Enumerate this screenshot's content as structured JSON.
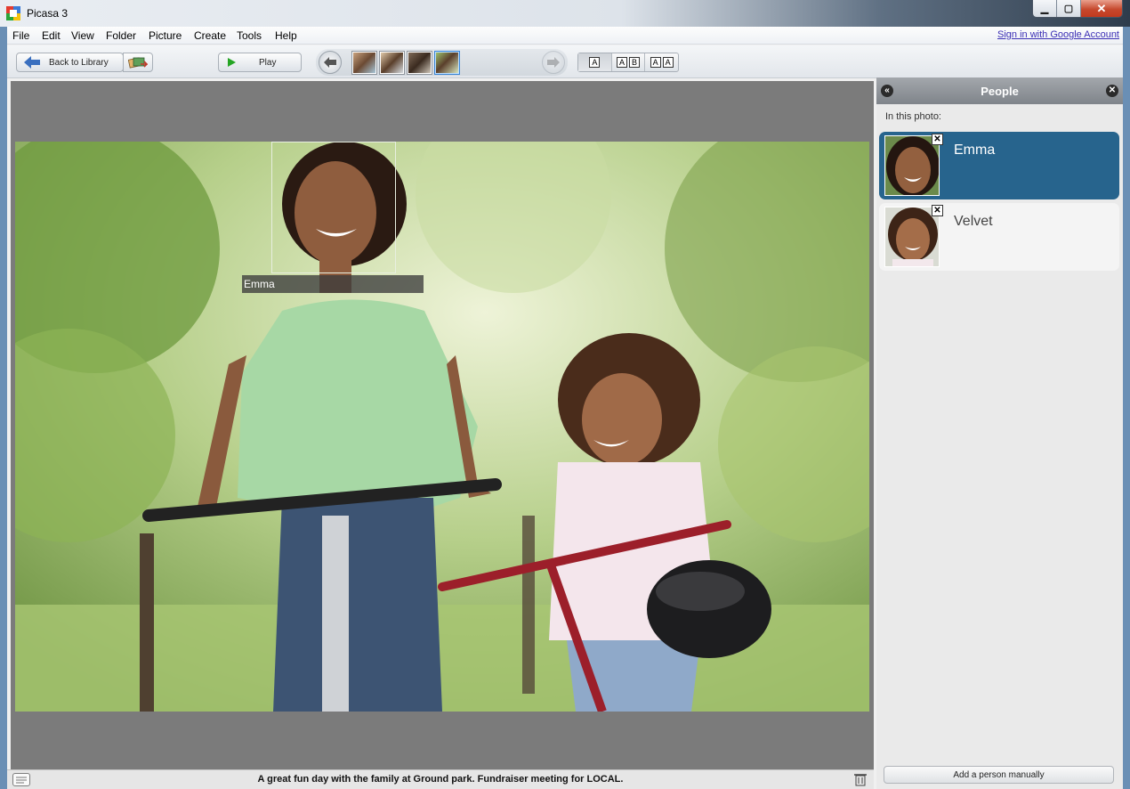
{
  "window": {
    "title": "Picasa 3",
    "min_glyph": "▁",
    "max_glyph": "▢",
    "close_glyph": "✕"
  },
  "menu": {
    "items": [
      {
        "label": "File"
      },
      {
        "label": "Edit"
      },
      {
        "label": "View"
      },
      {
        "label": "Folder"
      },
      {
        "label": "Picture"
      },
      {
        "label": "Create"
      },
      {
        "label": "Tools"
      },
      {
        "label": "Help"
      }
    ],
    "signin": "Sign in with Google Account"
  },
  "toolbar": {
    "back_label": "Back to Library",
    "play_label": "Play",
    "text_modes": [
      {
        "boxes": [
          "A"
        ]
      },
      {
        "boxes": [
          "A",
          "B"
        ]
      },
      {
        "boxes": [
          "A",
          "A"
        ]
      }
    ]
  },
  "photo": {
    "face_label": "Emma"
  },
  "caption": "A great fun day with the family at Ground park. Fundraiser meeting for LOCAL.",
  "people_panel": {
    "title": "People",
    "collapse_glyph": "«",
    "close_glyph": "✕",
    "in_photo_label": "In this photo:",
    "persons": [
      {
        "name": "Emma",
        "selected": true
      },
      {
        "name": "Velvet",
        "selected": false
      }
    ],
    "add_person_label": "Add a person manually"
  },
  "colors": {
    "selected_person_bg": "#27648d",
    "viewer_bg": "#7b7b7b",
    "play_icon": "#25a524",
    "link": "#3b2fb5"
  }
}
